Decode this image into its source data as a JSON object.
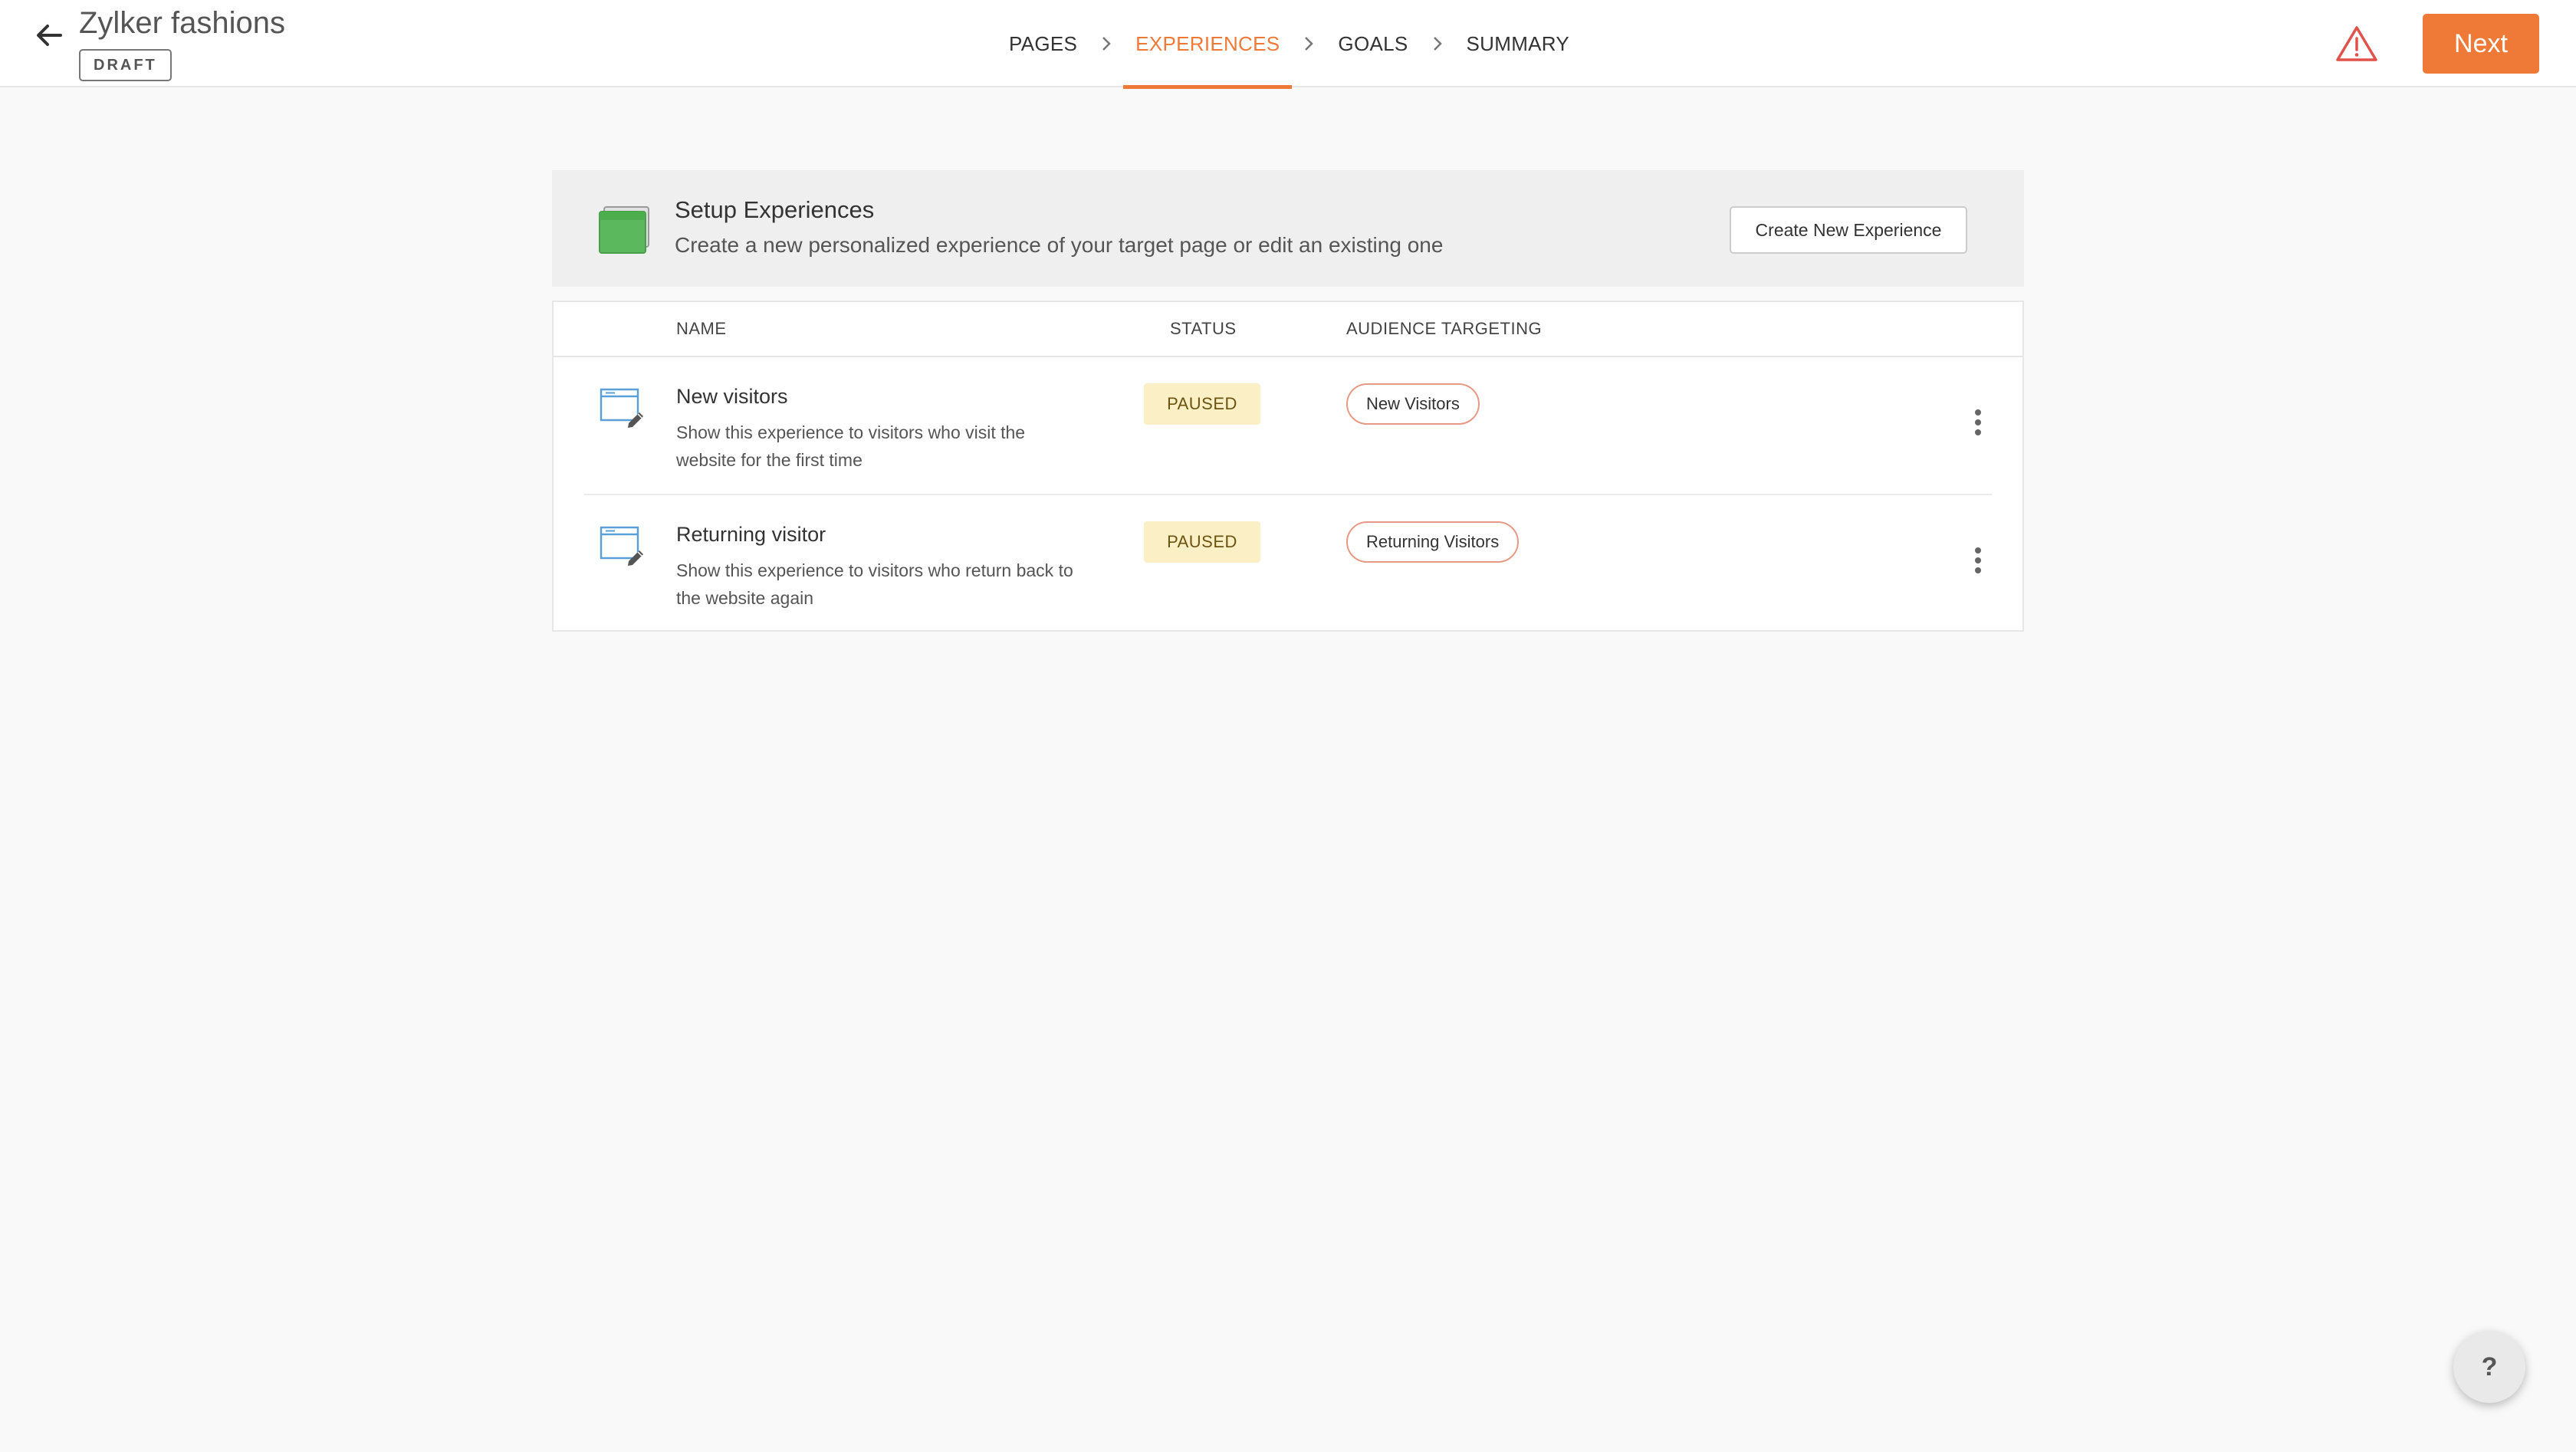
{
  "header": {
    "title": "Zylker fashions",
    "status_badge": "DRAFT",
    "steps": [
      {
        "label": "PAGES",
        "active": false
      },
      {
        "label": "EXPERIENCES",
        "active": true
      },
      {
        "label": "GOALS",
        "active": false
      },
      {
        "label": "SUMMARY",
        "active": false
      }
    ],
    "next_label": "Next",
    "icons": {
      "back": "arrow-left-icon",
      "warning": "warning-triangle-icon",
      "step_separator": "chevron-right-icon"
    }
  },
  "setup": {
    "title": "Setup Experiences",
    "description": "Create a new personalized experience of your target page or edit an existing one",
    "create_button": "Create New Experience",
    "icon": "browser-window-icon"
  },
  "table": {
    "columns": [
      "NAME",
      "STATUS",
      "AUDIENCE TARGETING"
    ],
    "rows": [
      {
        "name": "New visitors",
        "description": "Show this experience to visitors who visit the website for the first time",
        "status": "PAUSED",
        "audience": "New Visitors"
      },
      {
        "name": "Returning visitor",
        "description": "Show this experience to visitors who return back to the website again",
        "status": "PAUSED",
        "audience": "Returning Visitors"
      }
    ]
  },
  "help": {
    "label": "?"
  },
  "colors": {
    "accent": "#ef7a37",
    "paused_bg": "#fbefc5",
    "setup_icon": "#5cb85c",
    "warning": "#e0524a"
  }
}
